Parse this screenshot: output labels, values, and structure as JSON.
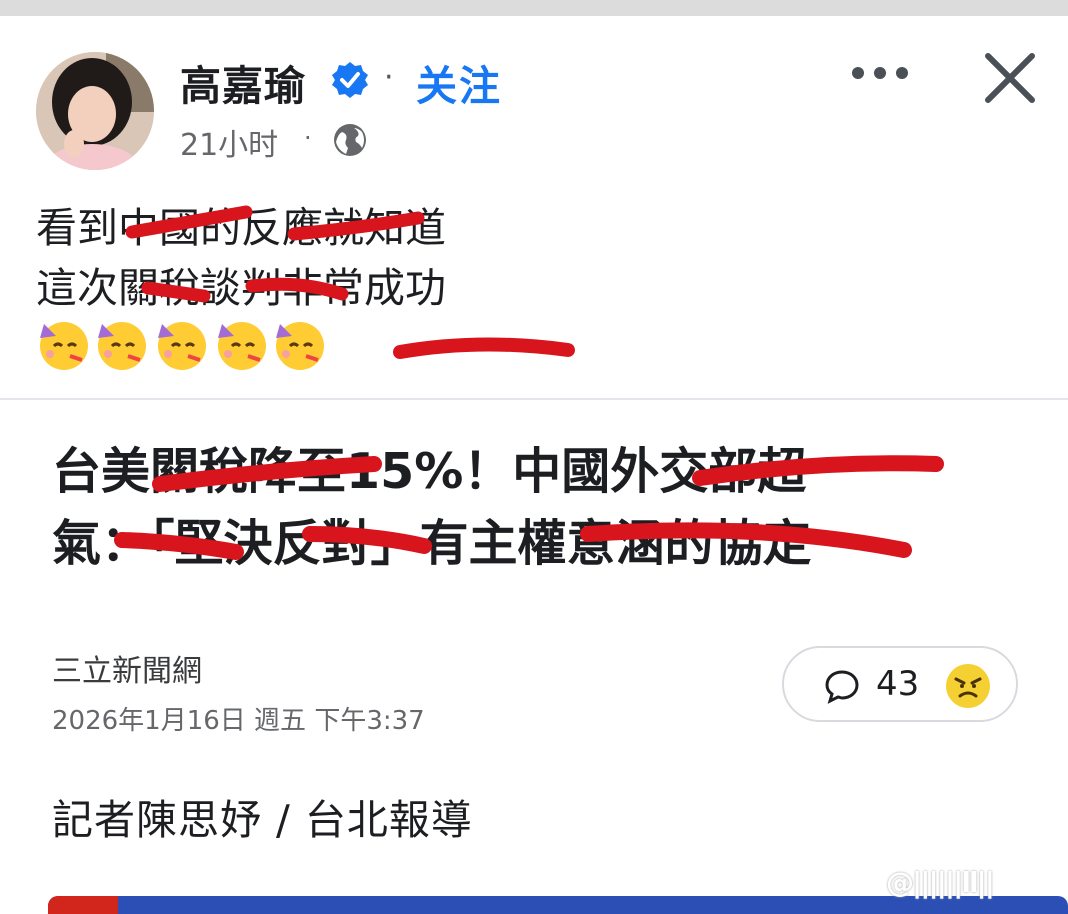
{
  "post": {
    "author": "高嘉瑜",
    "follow_label": "关注",
    "time": "21小时",
    "text_lines": [
      "看到中國的反應就知道",
      "這次關稅談判非常成功"
    ],
    "emoji_icons": [
      "partying-face-icon",
      "partying-face-icon",
      "partying-face-icon",
      "partying-face-icon",
      "partying-face-icon"
    ]
  },
  "article": {
    "headline_lines": [
      "台美關稅降至15%！中國外交部超",
      "氣：「堅決反對」有主權意涵的協定"
    ],
    "source": "三立新聞網",
    "date": "2026年1月16日 週五 下午3:37",
    "comment_count": "43",
    "byline": "記者陳思妤 / 台北報導"
  },
  "watermark": "@||||||ll||"
}
